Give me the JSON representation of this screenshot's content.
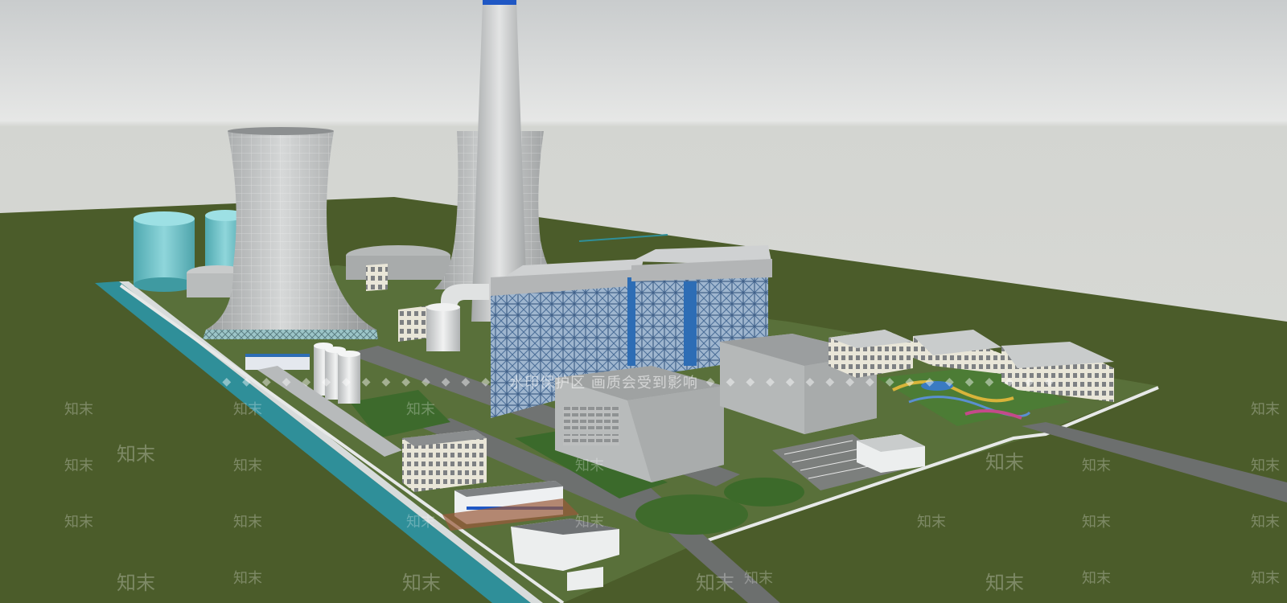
{
  "watermark": {
    "banner_text": "水印保护区 画质会受到影响",
    "brand": "知末"
  },
  "scene_colors": {
    "sky": "#d5d7d3",
    "ground": "#4d5e2c",
    "canal": "#2f8f99",
    "road": "#6c6f6e",
    "concrete": "#b8bbbb",
    "steel_blue": "#2d6db5",
    "tank_teal": "#6fc3c9"
  }
}
